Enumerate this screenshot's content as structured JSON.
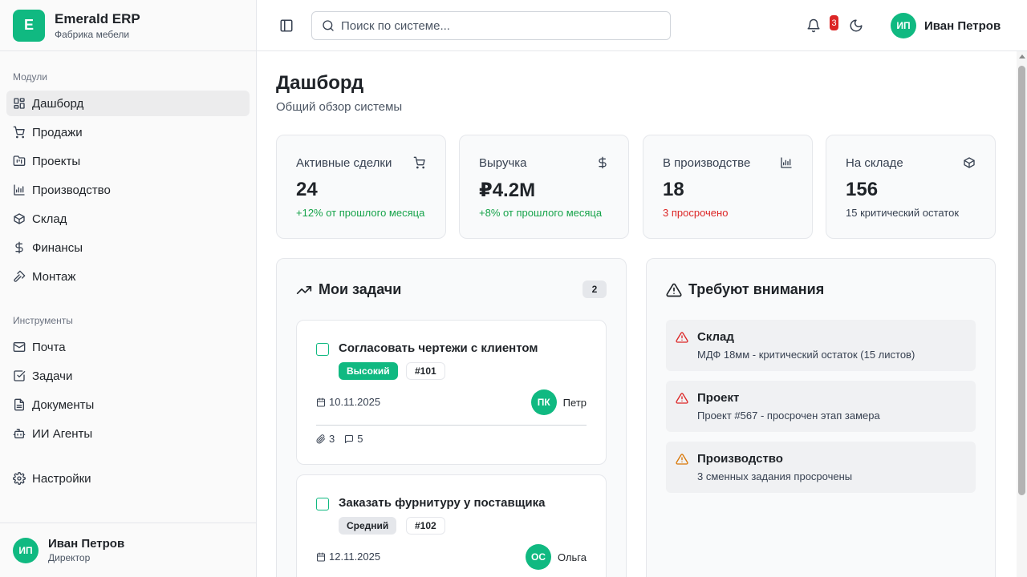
{
  "brand": {
    "logo_letter": "E",
    "name": "Emerald ERP",
    "subtitle": "Фабрика мебели"
  },
  "sidebar": {
    "sections": [
      {
        "label": "Модули"
      },
      {
        "label": "Инструменты"
      }
    ],
    "modules": [
      {
        "label": "Дашборд",
        "icon": "dashboard-icon",
        "active": true
      },
      {
        "label": "Продажи",
        "icon": "cart-icon"
      },
      {
        "label": "Проекты",
        "icon": "folder-kanban-icon"
      },
      {
        "label": "Производство",
        "icon": "factory-icon"
      },
      {
        "label": "Склад",
        "icon": "package-icon"
      },
      {
        "label": "Финансы",
        "icon": "dollar-icon"
      },
      {
        "label": "Монтаж",
        "icon": "hammer-icon"
      }
    ],
    "tools": [
      {
        "label": "Почта",
        "icon": "mail-icon"
      },
      {
        "label": "Задачи",
        "icon": "check-square-icon"
      },
      {
        "label": "Документы",
        "icon": "document-icon"
      },
      {
        "label": "ИИ Агенты",
        "icon": "bot-icon"
      }
    ],
    "settings": {
      "label": "Настройки",
      "icon": "gear-icon"
    },
    "user": {
      "initials": "ИП",
      "name": "Иван Петров",
      "role": "Директор"
    }
  },
  "header": {
    "search_placeholder": "Поиск по системе...",
    "notifications_count": "3",
    "user": {
      "initials": "ИП",
      "name": "Иван Петров"
    }
  },
  "page": {
    "title": "Дашборд",
    "subtitle": "Общий обзор системы"
  },
  "stats": [
    {
      "title": "Активные сделки",
      "value": "24",
      "note": "+12% от прошлого месяца",
      "note_color": "#16a34a",
      "icon": "cart-icon"
    },
    {
      "title": "Выручка",
      "value": "₽4.2M",
      "note": "+8% от прошлого месяца",
      "note_color": "#16a34a",
      "icon": "dollar-icon"
    },
    {
      "title": "В производстве",
      "value": "18",
      "note": "3 просрочено",
      "note_color": "#dc2626",
      "icon": "factory-icon"
    },
    {
      "title": "На складе",
      "value": "156",
      "note": "15 критический остаток",
      "note_color": "#374151",
      "icon": "package-icon"
    }
  ],
  "tasks_panel": {
    "title": "Мои задачи",
    "count": "2",
    "tasks": [
      {
        "title": "Согласовать чертежи с клиентом",
        "priority": "Высокий",
        "number": "#101",
        "date": "10.11.2025",
        "assignee_initials": "ПК",
        "assignee_name": "Петр",
        "attachments": "3",
        "comments": "5"
      },
      {
        "title": "Заказать фурнитуру у поставщика",
        "priority": "Средний",
        "number": "#102",
        "date": "12.11.2025",
        "assignee_initials": "ОС",
        "assignee_name": "Ольга"
      }
    ]
  },
  "attention_panel": {
    "title": "Требуют внимания",
    "alerts": [
      {
        "title": "Склад",
        "text": "МДФ 18мм - критический остаток (15 листов)",
        "color": "#dc2626"
      },
      {
        "title": "Проект",
        "text": "Проект #567 - просрочен этап замера",
        "color": "#dc2626"
      },
      {
        "title": "Производство",
        "text": "3 сменных задания просрочены",
        "color": "#d97706"
      }
    ]
  },
  "colors": {
    "accent": "#10b981",
    "danger": "#dc2626",
    "warning": "#d97706",
    "success": "#16a34a"
  }
}
